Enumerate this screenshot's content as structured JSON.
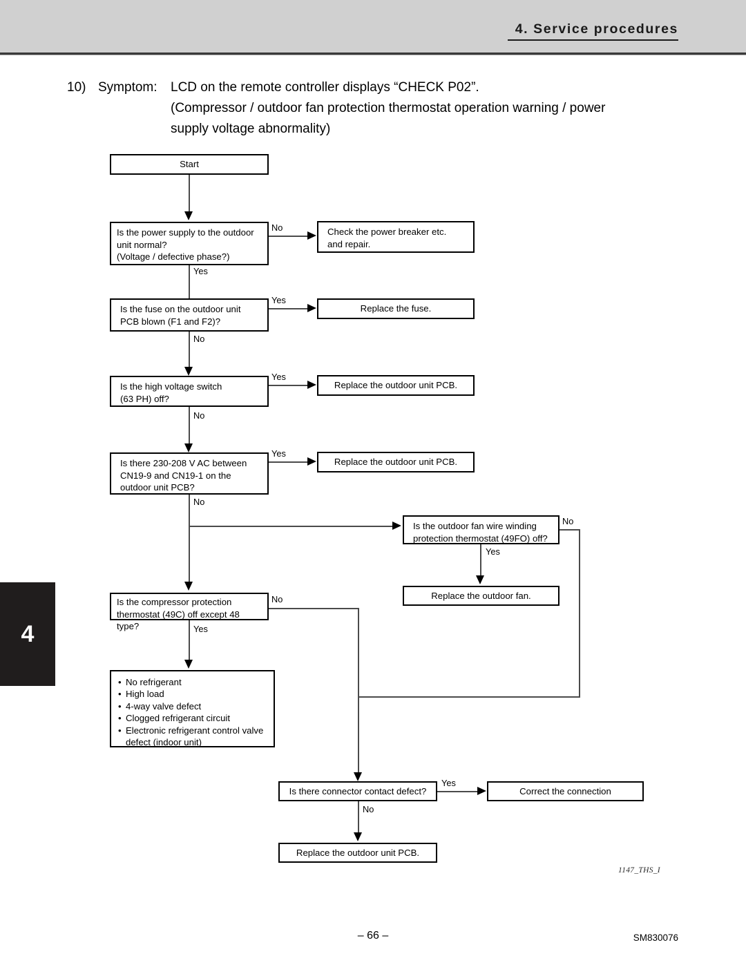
{
  "header": {
    "chapter_title": "4. Service procedures",
    "chapter_tab_number": "4"
  },
  "symptom": {
    "number": "10)",
    "label": "Symptom:",
    "line1": "LCD on the remote controller displays “CHECK P02”.",
    "line2": "(Compressor / outdoor fan protection thermostat operation warning / power",
    "line3": "supply voltage abnormality)"
  },
  "flowchart": {
    "nodes": {
      "start": "Start",
      "q_power_supply_l1": "Is the power supply to the outdoor",
      "q_power_supply_l2": "unit normal?",
      "q_power_supply_l3": "(Voltage / defective phase?)",
      "a_check_breaker_l1": "Check the power breaker etc.",
      "a_check_breaker_l2": "and repair.",
      "q_fuse_l1": "Is the fuse on the outdoor unit",
      "q_fuse_l2": "PCB blown (F1 and F2)?",
      "a_replace_fuse": "Replace the fuse.",
      "q_high_voltage_l1": "Is the high voltage switch",
      "q_high_voltage_l2": "(63 PH) off?",
      "a_replace_pcb_1": "Replace the outdoor unit PCB.",
      "q_voltage_cn19_l1": "Is there 230-208 V AC between",
      "q_voltage_cn19_l2": "CN19-9 and CN19-1 on the",
      "q_voltage_cn19_l3": "outdoor unit PCB?",
      "a_replace_pcb_2": "Replace the outdoor unit PCB.",
      "q_fan_thermostat_l1": "Is the outdoor fan wire winding",
      "q_fan_thermostat_l2": "protection thermostat (49FO) off?",
      "a_replace_fan": "Replace the outdoor fan.",
      "q_compressor_l1": "Is the compressor protection",
      "q_compressor_l2": "thermostat (49C) off except 48 type?",
      "causes": [
        "No refrigerant",
        "High load",
        "4-way valve defect",
        "Clogged refrigerant circuit",
        "Electronic refrigerant control valve"
      ],
      "causes_continuation": "defect (indoor unit)",
      "q_connector_defect": "Is there connector contact defect?",
      "a_correct_connection": "Correct the connection",
      "a_replace_pcb_3": "Replace the outdoor unit PCB."
    },
    "edge_labels": {
      "power_no": "No",
      "power_yes": "Yes",
      "fuse_yes": "Yes",
      "fuse_no": "No",
      "hv_yes": "Yes",
      "hv_no": "No",
      "cn19_yes": "Yes",
      "cn19_no": "No",
      "fan_no": "No",
      "fan_yes": "Yes",
      "comp_no": "No",
      "comp_yes": "Yes",
      "conn_yes": "Yes",
      "conn_no": "No"
    }
  },
  "footer": {
    "figure_code": "1147_THS_I",
    "page_number": "– 66 –",
    "document_code": "SM830076"
  }
}
